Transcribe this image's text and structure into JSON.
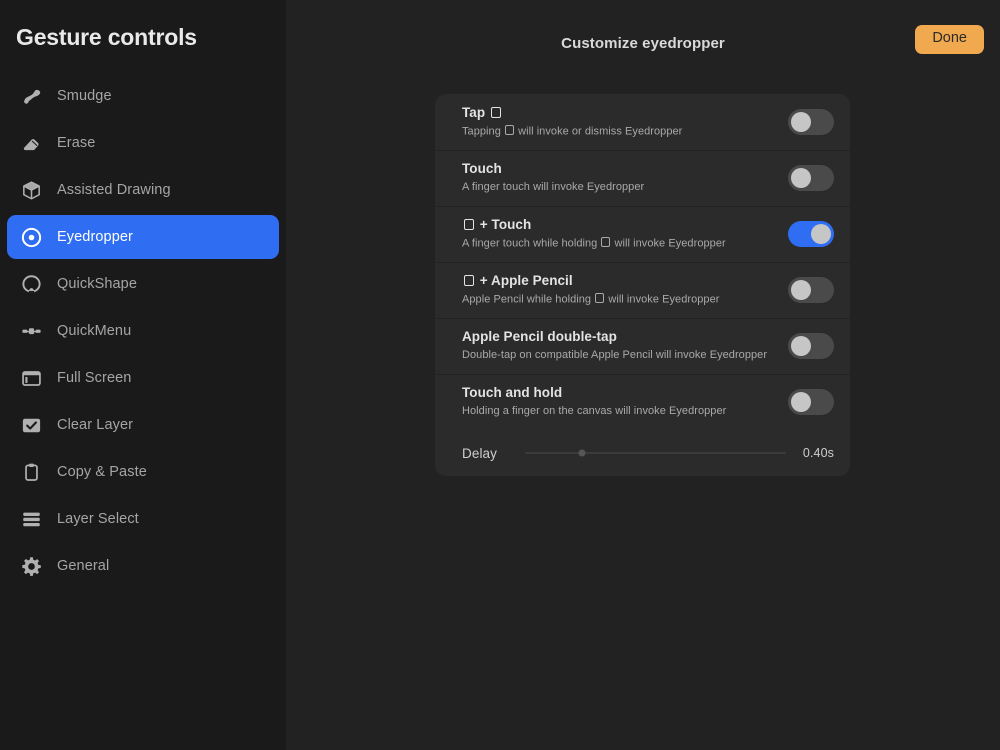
{
  "sidebar": {
    "title": "Gesture controls",
    "items": [
      {
        "label": "Smudge",
        "icon": "smudge-icon",
        "active": false
      },
      {
        "label": "Erase",
        "icon": "eraser-icon",
        "active": false
      },
      {
        "label": "Assisted Drawing",
        "icon": "cube-icon",
        "active": false
      },
      {
        "label": "Eyedropper",
        "icon": "eyedropper-target-icon",
        "active": true
      },
      {
        "label": "QuickShape",
        "icon": "quickshape-icon",
        "active": false
      },
      {
        "label": "QuickMenu",
        "icon": "quickmenu-icon",
        "active": false
      },
      {
        "label": "Full Screen",
        "icon": "fullscreen-icon",
        "active": false
      },
      {
        "label": "Clear Layer",
        "icon": "checkbox-checked-icon",
        "active": false
      },
      {
        "label": "Copy & Paste",
        "icon": "clipboard-icon",
        "active": false
      },
      {
        "label": "Layer Select",
        "icon": "layers-icon",
        "active": false
      },
      {
        "label": "General",
        "icon": "gear-icon",
        "active": false
      }
    ]
  },
  "header": {
    "title": "Customize eyedropper",
    "done_label": "Done"
  },
  "settings": {
    "rows": [
      {
        "title_before": "Tap ",
        "title_glyph": true,
        "title_after": "",
        "sub_before": "Tapping ",
        "sub_glyph": true,
        "sub_after": " will invoke or dismiss Eyedropper",
        "enabled": false
      },
      {
        "title_before": "Touch",
        "title_glyph": false,
        "title_after": "",
        "sub_before": "A finger touch will invoke Eyedropper",
        "sub_glyph": false,
        "sub_after": "",
        "enabled": false
      },
      {
        "title_before": "",
        "title_glyph": true,
        "title_after": " + Touch",
        "sub_before": "A finger touch while holding ",
        "sub_glyph": true,
        "sub_after": " will invoke Eyedropper",
        "enabled": true
      },
      {
        "title_before": "",
        "title_glyph": true,
        "title_after": " + Apple Pencil",
        "sub_before": "Apple Pencil while holding ",
        "sub_glyph": true,
        "sub_after": " will invoke Eyedropper",
        "enabled": false
      },
      {
        "title_before": "Apple Pencil double-tap",
        "title_glyph": false,
        "title_after": "",
        "sub_before": "Double-tap on compatible Apple Pencil will invoke Eyedropper",
        "sub_glyph": false,
        "sub_after": "",
        "enabled": false
      },
      {
        "title_before": "Touch and hold",
        "title_glyph": false,
        "title_after": "",
        "sub_before": "Holding a finger on the canvas will invoke Eyedropper",
        "sub_glyph": false,
        "sub_after": "",
        "enabled": false
      }
    ],
    "delay": {
      "label": "Delay",
      "value_text": "0.40s",
      "percent": 22
    }
  },
  "colors": {
    "accent_blue": "#2f6ef2",
    "done_orange": "#f0a94f",
    "sidebar_bg": "#1a1a1a",
    "main_bg": "#222222",
    "card_bg": "#2b2b2b"
  }
}
